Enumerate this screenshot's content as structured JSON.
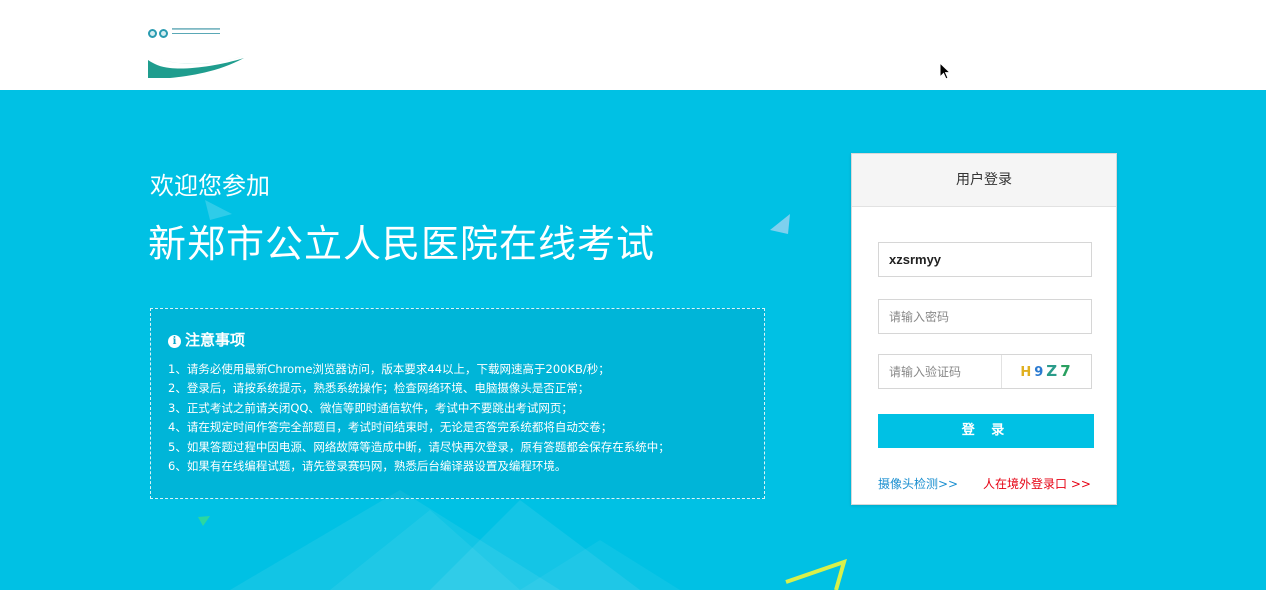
{
  "colors": {
    "accent": "#00c1e4",
    "link_blue": "#1a8fd0",
    "link_red": "#e60012"
  },
  "header": {
    "logo_icon": "hospital-logo"
  },
  "hero": {
    "welcome": "欢迎您参加",
    "title": "新郑市公立人民医院在线考试"
  },
  "notice": {
    "icon": "info-icon",
    "heading": "注意事项",
    "items": [
      "1、请务必使用最新Chrome浏览器访问，版本要求44以上，下载网速高于200KB/秒；",
      "2、登录后，请按系统提示，熟悉系统操作；检查网络环境、电脑摄像头是否正常；",
      "3、正式考试之前请关闭QQ、微信等即时通信软件，考试中不要跳出考试网页；",
      "4、请在规定时间作答完全部题目，考试时间结束时，无论是否答完系统都将自动交卷；",
      "5、如果答题过程中因电源、网络故障等造成中断，请尽快再次登录，原有答题都会保存在系统中；",
      "6、如果有在线编程试题，请先登录赛码网，熟悉后台编译器设置及编程环境。"
    ]
  },
  "login": {
    "heading": "用户登录",
    "username_value": "xzsrmyy",
    "password_placeholder": "请输入密码",
    "captcha_placeholder": "请输入验证码",
    "captcha_chars": [
      "H",
      "9",
      "Z",
      "7"
    ],
    "submit_label": "登 录",
    "camera_link": "摄像头检测>>",
    "overseas_link": "人在境外登录口 >>"
  }
}
